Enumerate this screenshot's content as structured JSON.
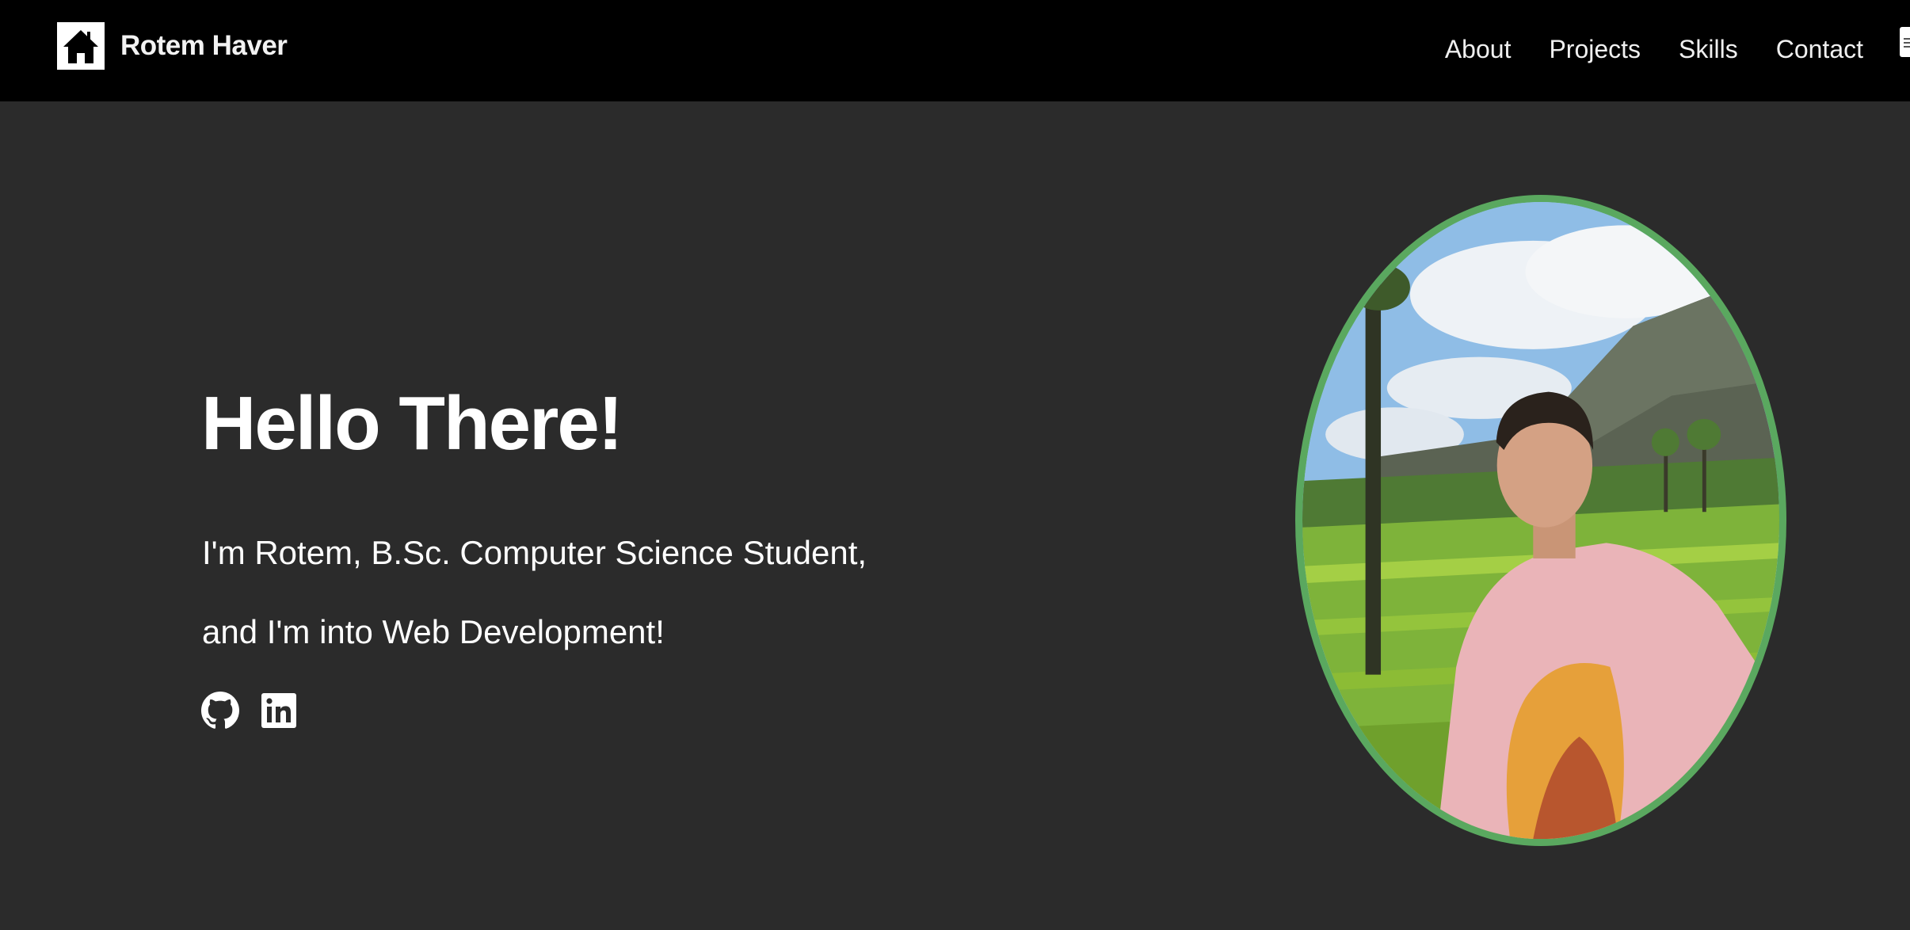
{
  "navbar": {
    "brand_name": "Rotem Haver",
    "brand_icon": "home-icon",
    "links": [
      {
        "label": "About"
      },
      {
        "label": "Projects"
      },
      {
        "label": "Skills"
      },
      {
        "label": "Contact"
      }
    ]
  },
  "hero": {
    "title": "Hello There!",
    "line1": "I'm Rotem, B.Sc. Computer Science Student,",
    "line2": "and I'm into Web Development!",
    "socials": [
      {
        "icon": "github-icon"
      },
      {
        "icon": "linkedin-icon"
      }
    ],
    "photo_alt": "Profile photo"
  },
  "colors": {
    "navbar_bg": "#000000",
    "page_bg": "#2b2b2b",
    "photo_border": "#5aa85f",
    "text": "#ffffff"
  }
}
